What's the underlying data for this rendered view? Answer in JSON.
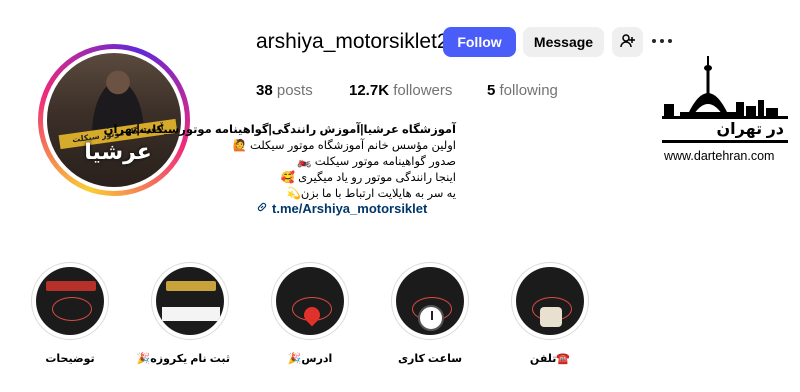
{
  "profile": {
    "username": "arshiya_motorsiklet2",
    "avatar_banner": "آموزشگاه موتور سیکلت",
    "avatar_name": "عرشیا"
  },
  "actions": {
    "follow_label": "Follow",
    "message_label": "Message",
    "add_user_icon": "person-add-icon",
    "more_icon": "more-horizontal-icon"
  },
  "stats": {
    "posts_count": "38",
    "posts_label": "posts",
    "followers_count": "12.7K",
    "followers_label": "followers",
    "following_count": "5",
    "following_label": "following"
  },
  "bio": {
    "title": "آموزشگاه عرشیا|آموزش رانندگی|گواهینامه موتورسیکلت|تهران",
    "line1": "اولین مؤسس خانم آموزشگاه موتور سیکلت 🙋",
    "line2": "صدور گواهینامه موتور سیکلت 🏍️",
    "line3": "اینجا رانندگی موتور رو یاد میگیری 🥰",
    "line4": "یه سر به هایلایت ارتباط با ما بزن💫",
    "link": "t.me/Arshiya_motorsiklet"
  },
  "watermark": {
    "logo_text": "در تهران",
    "url": "www.dartehran.com"
  },
  "highlights": [
    {
      "label": "توضیحات"
    },
    {
      "label": "ثبت نام یکروزه🎉"
    },
    {
      "label": "ادرس🎉"
    },
    {
      "label": "ساعت کاری"
    },
    {
      "label": "☎️تلفن"
    }
  ],
  "colors": {
    "follow_button": "#4a5df9",
    "link": "#00376b",
    "secondary_button": "#efefef"
  }
}
